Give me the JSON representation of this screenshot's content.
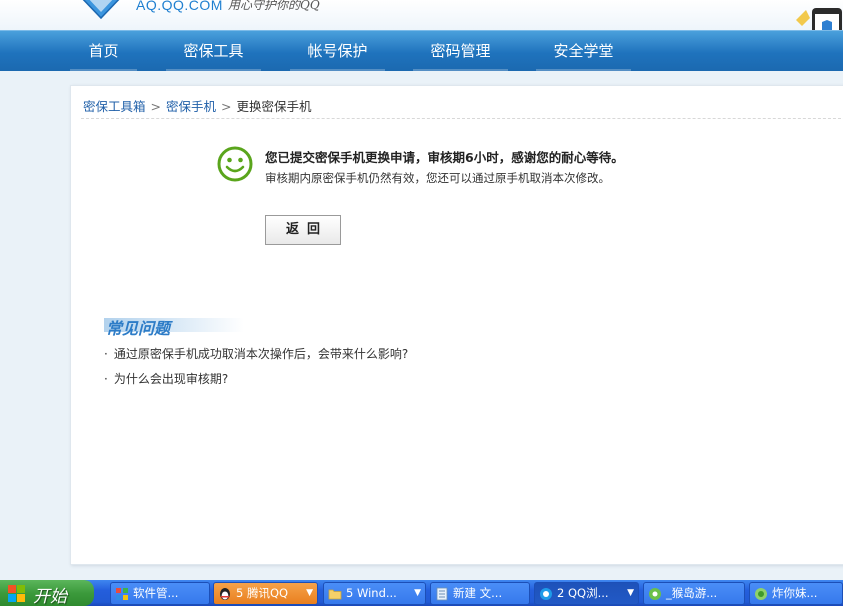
{
  "header": {
    "logo_text": "AQ.QQ.COM",
    "slogan": "用心守护你的QQ"
  },
  "nav": {
    "items": [
      {
        "label": "首页"
      },
      {
        "label": "密保工具"
      },
      {
        "label": "帐号保护"
      },
      {
        "label": "密码管理"
      },
      {
        "label": "安全学堂"
      }
    ]
  },
  "breadcrumb": {
    "items": [
      "密保工具箱",
      "密保手机",
      "更换密保手机"
    ],
    "separator": ">"
  },
  "message": {
    "title": "您已提交密保手机更换申请，审核期6小时，感谢您的耐心等待。",
    "subtitle": "审核期内原密保手机仍然有效，您还可以通过原手机取消本次修改。",
    "back_button": "返回"
  },
  "faq": {
    "title": "常见问题",
    "items": [
      "通过原密保手机成功取消本次操作后，会带来什么影响?",
      "为什么会出现审核期?"
    ]
  },
  "taskbar": {
    "start_label": "开始",
    "tasks": [
      {
        "label": "软件管..."
      },
      {
        "label": "5 腾讯QQ"
      },
      {
        "label": "5 Wind..."
      },
      {
        "label": "新建 文..."
      },
      {
        "label": "2 QQ浏..."
      },
      {
        "label": "_猴岛游..."
      },
      {
        "label": "炸你妹..."
      }
    ]
  },
  "colors": {
    "nav_blue": "#1f73bd",
    "link_blue": "#1f5fa8",
    "faq_title": "#2d7cc7",
    "smiley_green": "#5aa51c"
  }
}
